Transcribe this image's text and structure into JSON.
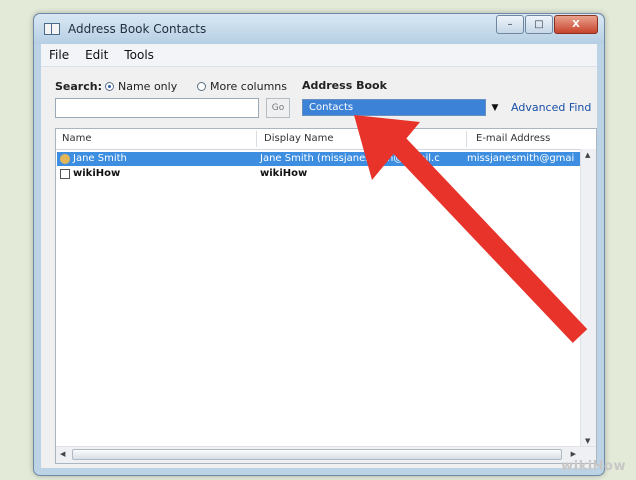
{
  "window": {
    "title": "Address Book Contacts",
    "controls": {
      "minimize": "–",
      "maximize": "□",
      "close": "X"
    }
  },
  "menu": [
    "File",
    "Edit",
    "Tools"
  ],
  "search": {
    "label": "Search:",
    "option_name_only": "Name only",
    "option_more_columns": "More columns",
    "input_value": "",
    "go_label": "Go"
  },
  "address_book": {
    "label": "Address Book",
    "selected": "Contacts",
    "advanced_find": "Advanced Find"
  },
  "list": {
    "columns": [
      "Name",
      "Display Name",
      "E-mail Address"
    ],
    "rows": [
      {
        "name": "Jane Smith",
        "display_name": "Jane Smith (missjanesmith@gmail.c",
        "email": "missjanesmith@gmai",
        "icon": "contact-icon",
        "selected": true
      },
      {
        "name": "wikiHow",
        "display_name": "wikiHow",
        "email": "",
        "icon": "group-icon",
        "selected": false
      }
    ]
  },
  "watermark": "wikiHow",
  "colors": {
    "selection": "#3d8ee0",
    "arrow": "#e8332a",
    "link": "#1a4fa6"
  }
}
